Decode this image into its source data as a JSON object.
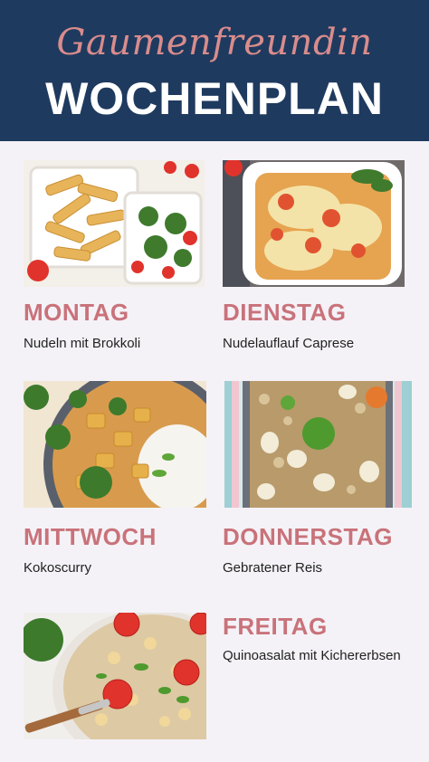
{
  "header": {
    "brand": "Gaumenfreundin",
    "title": "WOCHENPLAN"
  },
  "days": [
    {
      "day": "MONTAG",
      "dish": "Nudeln mit Brokkoli",
      "photo_icon": "pasta-lunchbox-photo"
    },
    {
      "day": "DIENSTAG",
      "dish": "Nudelauflauf Caprese",
      "photo_icon": "pasta-bake-photo"
    },
    {
      "day": "MITTWOCH",
      "dish": "Kokoscurry",
      "photo_icon": "coconut-curry-photo"
    },
    {
      "day": "DONNERSTAG",
      "dish": "Gebratener Reis",
      "photo_icon": "fried-rice-photo"
    },
    {
      "day": "FREITAG",
      "dish": "Quinoasalat mit Kichererbsen",
      "photo_icon": "quinoa-salad-photo"
    }
  ],
  "colors": {
    "header_bg": "#1f3a5f",
    "brand": "#d98c8c",
    "day_label": "#c9727a",
    "page_bg": "#f4f2f7"
  }
}
